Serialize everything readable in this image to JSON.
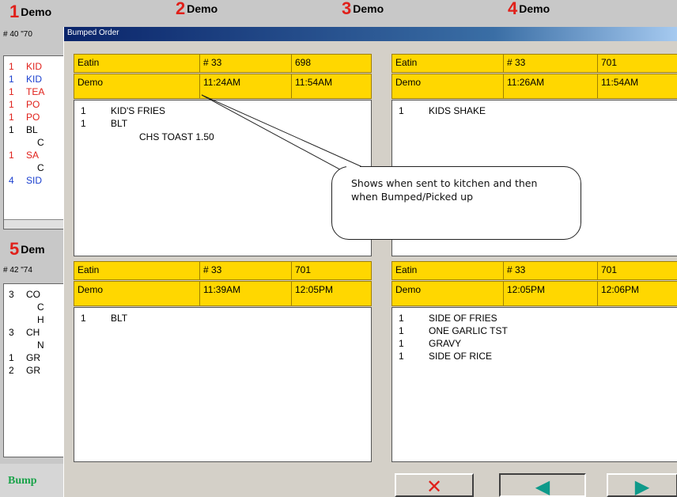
{
  "background": {
    "top_orders": [
      {
        "num": "1",
        "name": "Demo"
      },
      {
        "num": "2",
        "name": "Demo"
      },
      {
        "num": "3",
        "name": "Demo"
      },
      {
        "num": "4",
        "name": "Demo"
      }
    ],
    "order_1": {
      "sub": "# 40 \"70",
      "lines": [
        {
          "qty": "1",
          "name": "KID",
          "color": "#e0201a"
        },
        {
          "qty": "1",
          "name": "KID",
          "color": "#1a3fcf"
        },
        {
          "qty": "1",
          "name": "TEA",
          "color": "#e0201a"
        },
        {
          "qty": "1",
          "name": "PO",
          "color": "#e0201a"
        },
        {
          "qty": "1",
          "name": "PO",
          "color": "#e0201a"
        },
        {
          "qty": "1",
          "name": "BL",
          "color": "#000000"
        },
        {
          "qty": "",
          "name": "C",
          "color": "#000000"
        },
        {
          "qty": "1",
          "name": "SA",
          "color": "#e0201a"
        },
        {
          "qty": "",
          "name": "C",
          "color": "#000000"
        },
        {
          "qty": "4",
          "name": "SID",
          "color": "#1a3fcf"
        }
      ]
    },
    "order_5": {
      "num": "5",
      "name": "Dem",
      "sub": "# 42 \"74",
      "lines": [
        {
          "qty": "3",
          "name": "CO",
          "color": "#000000"
        },
        {
          "qty": "",
          "name": "C",
          "color": "#000000"
        },
        {
          "qty": "",
          "name": "H",
          "color": "#000000"
        },
        {
          "qty": "3",
          "name": "CH",
          "color": "#000000"
        },
        {
          "qty": "",
          "name": "N",
          "color": "#000000"
        },
        {
          "qty": "1",
          "name": "GR",
          "color": "#000000"
        },
        {
          "qty": "2",
          "name": "GR",
          "color": "#000000"
        }
      ]
    },
    "bump_label": "Bump"
  },
  "dialog": {
    "title": "Bumped Order",
    "orders": [
      {
        "type": "Eatin",
        "number": "# 33",
        "ticket": "698",
        "server": "Demo",
        "sent": "11:24AM",
        "bumped": "11:54AM",
        "items": [
          {
            "qty": "1",
            "name": "KID'S FRIES"
          },
          {
            "qty": "1",
            "name": "BLT"
          },
          {
            "qty": "",
            "name": "CHS TOAST 1.50"
          }
        ]
      },
      {
        "type": "Eatin",
        "number": "# 33",
        "ticket": "701",
        "server": "Demo",
        "sent": "11:26AM",
        "bumped": "11:54AM",
        "items": [
          {
            "qty": "1",
            "name": "KIDS SHAKE"
          }
        ]
      },
      {
        "type": "Eatin",
        "number": "# 33",
        "ticket": "701",
        "server": "Demo",
        "sent": "11:39AM",
        "bumped": "12:05PM",
        "items": [
          {
            "qty": "1",
            "name": "BLT"
          }
        ]
      },
      {
        "type": "Eatin",
        "number": "# 33",
        "ticket": "701",
        "server": "Demo",
        "sent": "12:05PM",
        "bumped": "12:06PM",
        "items": [
          {
            "qty": "1",
            "name": "SIDE OF FRIES"
          },
          {
            "qty": "1",
            "name": "ONE GARLIC TST"
          },
          {
            "qty": "1",
            "name": "GRAVY"
          },
          {
            "qty": "1",
            "name": "SIDE OF RICE"
          }
        ]
      }
    ],
    "buttons": {
      "close_glyph": "✕",
      "prev_glyph": "◀",
      "next_glyph": "▶",
      "close_icon": "close-x-icon",
      "prev_icon": "arrow-left-icon",
      "next_icon": "arrow-right-icon"
    }
  },
  "callout": {
    "text": "Shows when sent to kitchen and then when Bumped/Picked up"
  },
  "colors": {
    "header_yellow": "#ffd700",
    "red": "#e0201a",
    "blue": "#1a3fcf",
    "green": "#1aa34a",
    "titlebar": "#0a246a"
  }
}
